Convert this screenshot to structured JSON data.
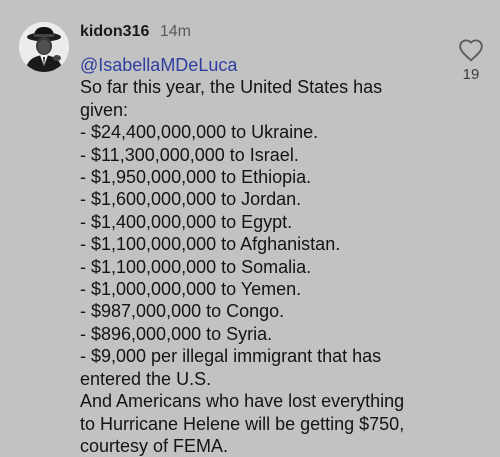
{
  "comment": {
    "username": "kidon316",
    "timestamp": "14m",
    "mention": "@IsabellaMDeLuca",
    "lines": [
      "So far this year, the United States has",
      "given:",
      "- $24,400,000,000 to Ukraine.",
      "- $11,300,000,000 to Israel.",
      "- $1,950,000,000 to Ethiopia.",
      "- $1,600,000,000 to Jordan.",
      "- $1,400,000,000 to Egypt.",
      "- $1,100,000,000 to Afghanistan.",
      "- $1,100,000,000 to Somalia.",
      "- $1,000,000,000 to Yemen.",
      "- $987,000,000 to Congo.",
      "- $896,000,000 to Syria.",
      "- $9,000 per illegal immigrant that has",
      "entered the U.S.",
      "And Americans who have lost everything",
      "to Hurricane Helene will be getting $750,",
      "courtesy of FEMA."
    ],
    "like_count": "19",
    "like_icon": "heart-outline-icon"
  },
  "colors": {
    "background": "#c2c2c2",
    "mention": "#2f3fa0",
    "text": "#141414"
  }
}
